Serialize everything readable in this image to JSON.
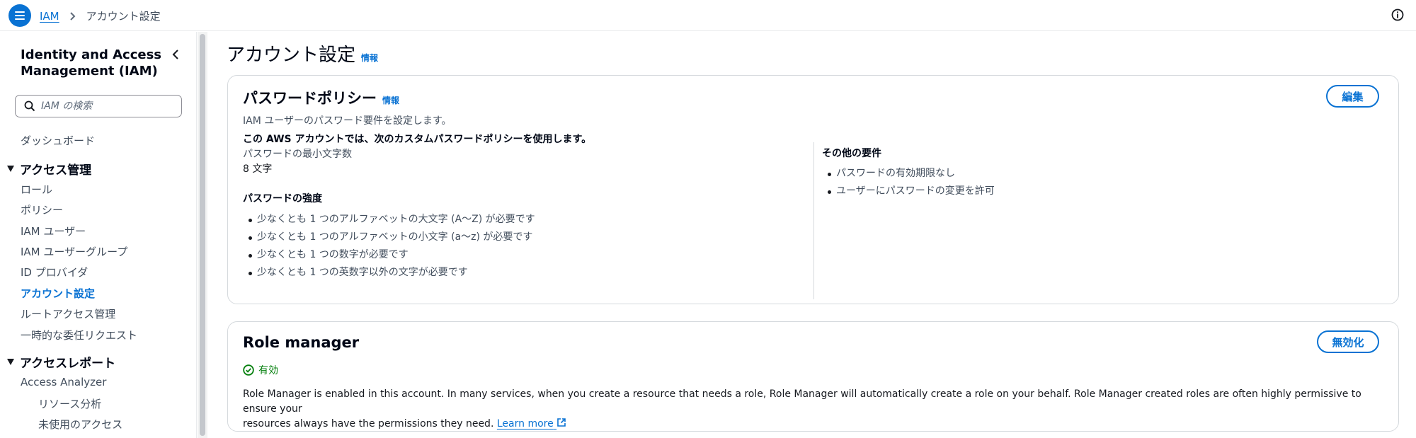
{
  "breadcrumb": {
    "root": "IAM",
    "current": "アカウント設定"
  },
  "sidebar": {
    "title": "Identity and Access Management (IAM)",
    "search_placeholder": "IAM の検索",
    "dashboard": "ダッシュボード",
    "section_access": "アクセス管理",
    "access_items": [
      "ロール",
      "ポリシー",
      "IAM ユーザー",
      "IAM ユーザーグループ",
      "ID プロバイダ",
      "アカウント設定",
      "ルートアクセス管理",
      "一時的な委任リクエスト"
    ],
    "active_item": "アカウント設定",
    "section_reports": "アクセスレポート",
    "reports_items": [
      "Access Analyzer"
    ],
    "reports_subitems": [
      "リソース分析",
      "未使用のアクセス"
    ]
  },
  "page": {
    "title": "アカウント設定",
    "info": "情報"
  },
  "password_policy": {
    "title": "パスワードポリシー",
    "info": "情報",
    "edit_button": "編集",
    "description": "IAM ユーザーのパスワード要件を設定します。",
    "custom_policy_heading": "この AWS アカウントでは、次のカスタムパスワードポリシーを使用します。",
    "min_length_label": "パスワードの最小文字数",
    "min_length_value": "8 文字",
    "strength_heading": "パスワードの強度",
    "strength_items": [
      "少なくとも 1 つのアルファベットの大文字 (A～Z) が必要です",
      "少なくとも 1 つのアルファベットの小文字 (a～z) が必要です",
      "少なくとも 1 つの数字が必要です",
      "少なくとも 1 つの英数字以外の文字が必要です"
    ],
    "other_heading": "その他の要件",
    "other_items": [
      "パスワードの有効期限なし",
      "ユーザーにパスワードの変更を許可"
    ]
  },
  "role_manager": {
    "title": "Role manager",
    "disable_button": "無効化",
    "status": "有効",
    "status_color": "#037f0c",
    "description_line1": "Role Manager is enabled in this account. In many services, when you create a resource that needs a role, Role Manager will automatically create a role on your behalf. Role Manager created roles are often highly permissive to ensure your",
    "description_line2": "resources always have the permissions they need.",
    "learn_more": "Learn more"
  },
  "icons": {
    "menu": "hamburger-menu-icon",
    "breadcrumb_separator": "chevron-right-icon",
    "info": "info-circle-icon",
    "collapse": "chevron-left-icon",
    "search": "search-icon",
    "status": "check-circle-icon",
    "external": "external-link-icon"
  },
  "colors": {
    "accent": "#0972d3",
    "success": "#037f0c"
  }
}
